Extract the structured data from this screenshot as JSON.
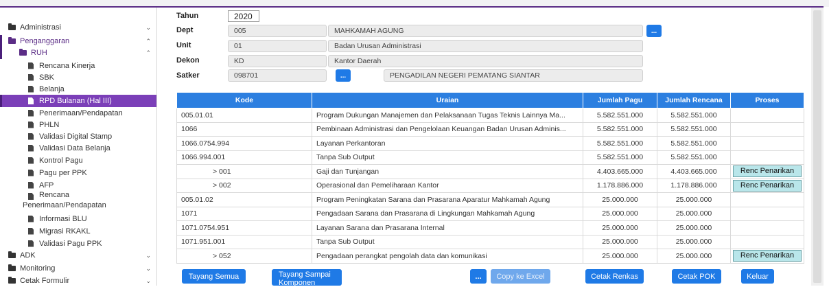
{
  "sidebar": {
    "items": [
      {
        "label": "Administrasi",
        "icon": "folder-icon",
        "chevron": "chevron-down-icon",
        "chev_glyph": "⌄"
      },
      {
        "label": "Penganggaran",
        "icon": "folder-icon",
        "chevron": "chevron-up-icon",
        "chev_glyph": "⌃"
      },
      {
        "label": "RUH",
        "icon": "folder-icon",
        "chevron": "chevron-up-icon",
        "chev_glyph": "⌃"
      },
      {
        "label": "Rencana Kinerja"
      },
      {
        "label": "SBK"
      },
      {
        "label": "Belanja"
      },
      {
        "label": "RPD Bulanan (Hal III)"
      },
      {
        "label": "Penerimaan/Pendapatan"
      },
      {
        "label": "PHLN"
      },
      {
        "label": "Validasi Digital Stamp"
      },
      {
        "label": "Validasi Data Belanja"
      },
      {
        "label": "Kontrol Pagu"
      },
      {
        "label": "Pagu per PPK"
      },
      {
        "label": "AFP"
      },
      {
        "label": "Rencana",
        "label2": "Penerimaan/Pendapatan"
      },
      {
        "label": "Informasi BLU"
      },
      {
        "label": "Migrasi RKAKL"
      },
      {
        "label": "Validasi Pagu PPK"
      },
      {
        "label": "ADK",
        "chev_glyph": "⌄"
      },
      {
        "label": "Monitoring",
        "chev_glyph": "⌄"
      },
      {
        "label": "Cetak Formulir",
        "chev_glyph": "⌄"
      }
    ]
  },
  "form": {
    "tahun_label": "Tahun",
    "tahun_value": "2020",
    "dept_label": "Dept",
    "dept_code": "005",
    "dept_name": "MAHKAMAH AGUNG",
    "unit_label": "Unit",
    "unit_code": "01",
    "unit_name": "Badan Urusan Administrasi",
    "dekon_label": "Dekon",
    "dekon_code": "KD",
    "dekon_name": "Kantor Daerah",
    "satker_label": "Satker",
    "satker_code": "098701",
    "satker_name": "PENGADILAN NEGERI PEMATANG SIANTAR",
    "dots": "..."
  },
  "table": {
    "headers": [
      "Kode",
      "Uraian",
      "Jumlah Pagu",
      "Jumlah Rencana",
      "Proses"
    ],
    "rows": [
      {
        "kode": "005.01.01",
        "uraian": "Program Dukungan Manajemen dan Pelaksanaan Tugas Teknis Lainnya Ma...",
        "pagu": "5.582.551.000",
        "rencana": "5.582.551.000",
        "proses": ""
      },
      {
        "kode": "1066",
        "uraian": "Pembinaan Administrasi dan Pengelolaan Keuangan Badan Urusan Adminis...",
        "pagu": "5.582.551.000",
        "rencana": "5.582.551.000",
        "proses": ""
      },
      {
        "kode": "1066.0754.994",
        "uraian": "Layanan Perkantoran",
        "pagu": "5.582.551.000",
        "rencana": "5.582.551.000",
        "proses": ""
      },
      {
        "kode": "1066.994.001",
        "uraian": "Tanpa Sub Output",
        "pagu": "5.582.551.000",
        "rencana": "5.582.551.000",
        "proses": ""
      },
      {
        "kode": "> 001",
        "sub": true,
        "uraian": "Gaji dan Tunjangan",
        "pagu": "4.403.665.000",
        "rencana": "4.403.665.000",
        "proses": "Renc Penarikan"
      },
      {
        "kode": "> 002",
        "sub": true,
        "uraian": "Operasional dan Pemeliharaan Kantor",
        "pagu": "1.178.886.000",
        "rencana": "1.178.886.000",
        "proses": "Renc Penarikan"
      },
      {
        "kode": "005.01.02",
        "uraian": "Program Peningkatan Sarana dan Prasarana Aparatur Mahkamah Agung",
        "pagu": "25.000.000",
        "rencana": "25.000.000",
        "proses": ""
      },
      {
        "kode": "1071",
        "uraian": "Pengadaan Sarana dan Prasarana di Lingkungan Mahkamah Agung",
        "pagu": "25.000.000",
        "rencana": "25.000.000",
        "proses": ""
      },
      {
        "kode": "1071.0754.951",
        "uraian": "Layanan Sarana dan Prasarana Internal",
        "pagu": "25.000.000",
        "rencana": "25.000.000",
        "proses": ""
      },
      {
        "kode": "1071.951.001",
        "uraian": "Tanpa Sub Output",
        "pagu": "25.000.000",
        "rencana": "25.000.000",
        "proses": ""
      },
      {
        "kode": "> 052",
        "sub": true,
        "uraian": "Pengadaan perangkat pengolah data dan komunikasi",
        "pagu": "25.000.000",
        "rencana": "25.000.000",
        "proses": "Renc Penarikan"
      }
    ]
  },
  "buttons": {
    "tayang_semua": "Tayang Semua",
    "tayang_sampai": "Tayang Sampai",
    "tayang_sampai_2": "Komponen",
    "dots": "...",
    "copy_excel": "Copy ke Excel",
    "cetak_renkas": "Cetak Renkas",
    "cetak_pok": "Cetak POK",
    "keluar": "Keluar"
  },
  "colors": {
    "accent": "#5b2d86",
    "primary": "#1f7ae6",
    "header": "#2c7fe0",
    "selected": "#7b3fb8",
    "renc_btn": "#b9e6ea"
  }
}
